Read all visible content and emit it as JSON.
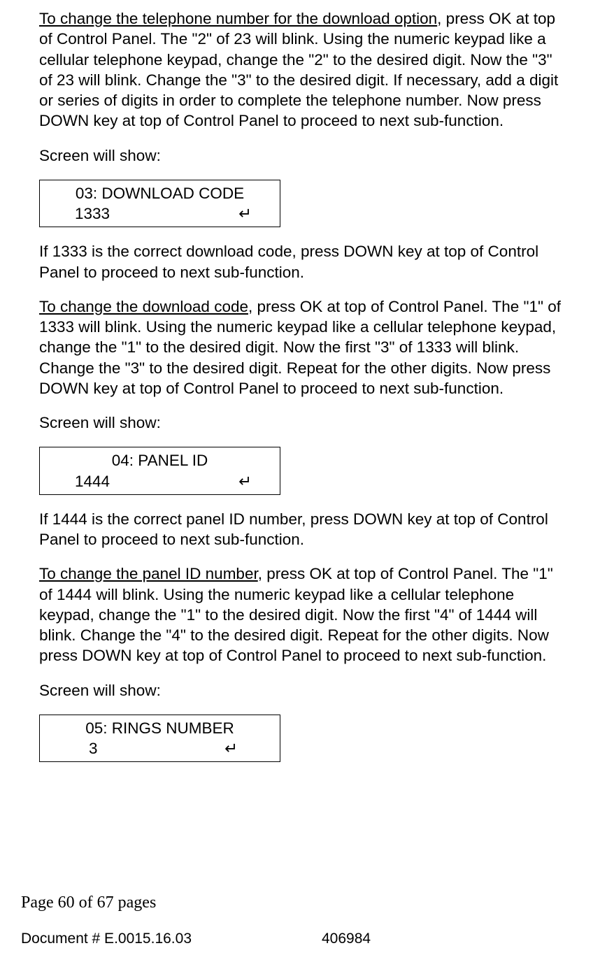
{
  "para1": {
    "lead": "To change the telephone number for the download option",
    "rest": ", press OK at top of Control Panel. The \"2\" of 23 will blink. Using the numeric keypad like a cellular telephone keypad, change the \"2\" to the desired digit. Now the \"3\" of 23 will blink. Change the \"3\" to the desired digit. If necessary, add a digit or series of digits in order to complete the telephone number. Now press DOWN key at top of Control Panel to proceed to next sub-function."
  },
  "screen_label": "Screen will show:",
  "lcd1": {
    "title": "03: DOWNLOAD CODE",
    "value": "1333",
    "ret": "↵"
  },
  "para2": "If 1333 is the correct download code, press DOWN key at top of Control Panel to proceed to next sub-function.",
  "para3": {
    "lead": "To change the download code",
    "rest": ", press OK at top of Control Panel. The \"1\" of 1333 will blink. Using the numeric keypad like a cellular telephone keypad, change the \"1\" to the desired digit. Now the first \"3\" of 1333 will blink. Change the \"3\" to the desired digit. Repeat for the other digits. Now press DOWN key at top of Control Panel to proceed to next sub-function."
  },
  "lcd2": {
    "title": "04: PANEL ID",
    "value": "1444",
    "ret": "↵"
  },
  "para4": "If 1444 is the correct panel ID number, press DOWN key at top of Control Panel to proceed to next sub-function.",
  "para5": {
    "lead": "To change the panel ID number",
    "rest": ", press OK at top of Control Panel. The \"1\" of 1444 will blink. Using the numeric keypad like a cellular telephone keypad, change the \"1\" to the desired digit. Now the first \"4\" of 1444 will blink. Change the \"4\" to the desired digit. Repeat for the other digits. Now press DOWN key at top of Control Panel to proceed to next sub-function."
  },
  "lcd3": {
    "title": "05: RINGS NUMBER",
    "value": "3",
    "ret": "↵"
  },
  "footer": {
    "page": "Page 60 of  67 pages",
    "docnum": "Document # E.0015.16.03",
    "docid": "406984"
  }
}
